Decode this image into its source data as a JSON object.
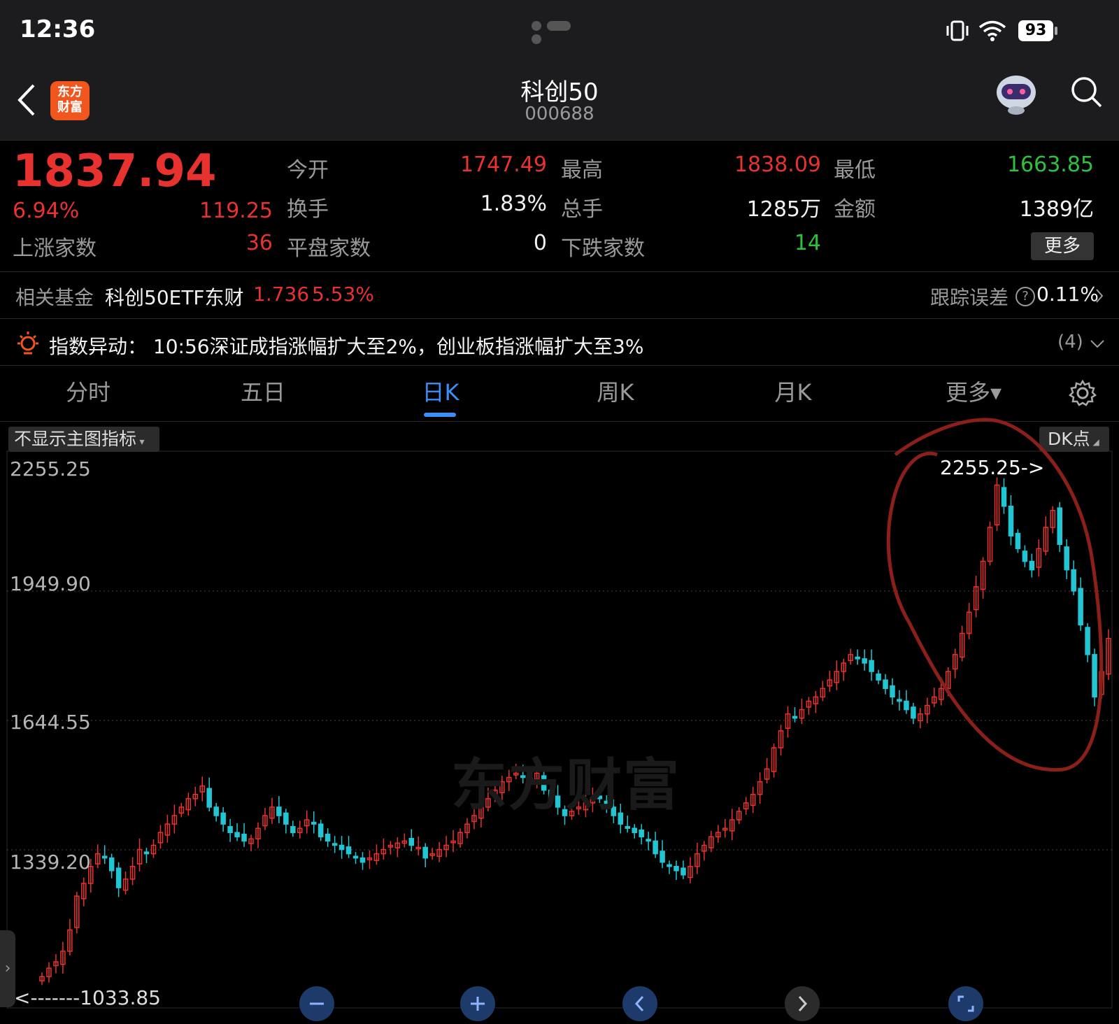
{
  "status_bar": {
    "time": "12:36",
    "battery": "93"
  },
  "nav": {
    "title": "科创50",
    "code": "000688",
    "logo_line1": "东方",
    "logo_line2": "财富"
  },
  "quote": {
    "price": "1837.94",
    "change_pct": "6.94%",
    "change": "119.25",
    "fields": {
      "open_label": "今开",
      "open": "1747.49",
      "high_label": "最高",
      "high": "1838.09",
      "low_label": "最低",
      "low": "1663.85",
      "turnover_label": "换手",
      "turnover": "1.83%",
      "volume_label": "总手",
      "volume": "1285万",
      "amount_label": "金额",
      "amount": "1389亿",
      "up_label": "上涨家数",
      "up": "36",
      "flat_label": "平盘家数",
      "flat": "0",
      "down_label": "下跌家数",
      "down": "14"
    },
    "more_label": "更多"
  },
  "fund": {
    "label": "相关基金",
    "name": "科创50ETF东财",
    "price": "1.736",
    "pct": "5.53%",
    "tracking_label": "跟踪误差",
    "tracking_value": "0.11%"
  },
  "alert": {
    "text": "指数异动：  10:56深证成指涨幅扩大至2%，创业板指涨幅扩大至3%",
    "count": "(4)"
  },
  "tabs": [
    "分时",
    "五日",
    "日K",
    "周K",
    "月K",
    "更多▾"
  ],
  "active_tab": "日K",
  "chart_controls": {
    "indicator_select": "不显示主图指标",
    "dk_label": "DK点"
  },
  "watermark": "东方财富",
  "chart_data": {
    "type": "candlestick",
    "y_ticks": [
      "2255.25",
      "1949.90",
      "1644.55",
      "1339.20"
    ],
    "ylim": [
      1033.85,
      2255.25
    ],
    "max_label": "2255.25->",
    "min_label": "<-------1033.85",
    "up_color": "#e8322f",
    "down_color": "#21c6d4",
    "closes": [
      1040,
      1060,
      1075,
      1100,
      1150,
      1230,
      1260,
      1300,
      1330,
      1320,
      1290,
      1250,
      1270,
      1300,
      1340,
      1330,
      1350,
      1380,
      1400,
      1420,
      1440,
      1460,
      1470,
      1490,
      1440,
      1420,
      1400,
      1380,
      1370,
      1360,
      1365,
      1390,
      1420,
      1440,
      1420,
      1400,
      1380,
      1390,
      1410,
      1400,
      1370,
      1360,
      1350,
      1340,
      1330,
      1320,
      1310,
      1320,
      1330,
      1340,
      1350,
      1355,
      1360,
      1350,
      1345,
      1320,
      1330,
      1340,
      1350,
      1360,
      1380,
      1400,
      1420,
      1440,
      1460,
      1480,
      1500,
      1510,
      1520,
      1510,
      1500,
      1520,
      1480,
      1460,
      1440,
      1420,
      1430,
      1440,
      1450,
      1460,
      1460,
      1440,
      1420,
      1400,
      1390,
      1380,
      1370,
      1360,
      1330,
      1310,
      1300,
      1290,
      1280,
      1300,
      1330,
      1350,
      1370,
      1380,
      1390,
      1410,
      1430,
      1450,
      1470,
      1500,
      1530,
      1580,
      1620,
      1660,
      1650,
      1670,
      1690,
      1700,
      1720,
      1740,
      1760,
      1780,
      1800,
      1790,
      1780,
      1760,
      1740,
      1720,
      1700,
      1690,
      1670,
      1650,
      1660,
      1680,
      1700,
      1720,
      1760,
      1800,
      1850,
      1900,
      1960,
      2020,
      2100,
      2200,
      2150,
      2080,
      2050,
      2020,
      2000,
      2050,
      2100,
      2140,
      2060,
      2000,
      1950,
      1870,
      1800,
      1700,
      1760,
      1838
    ]
  }
}
